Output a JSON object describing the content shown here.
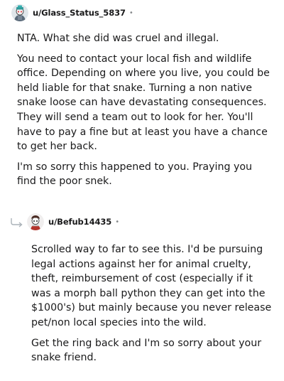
{
  "comment": {
    "author": "u/Glass_Status_5837",
    "separator": "•",
    "paragraphs": [
      "NTA. What she did was cruel and illegal.",
      "You need to contact your local fish and wildlife office. Depending on where you live, you could be held liable for that snake. Turning a non native snake loose can have devastating consequences. They will send a team out to look for her. You'll have to pay a fine but at least you have a chance to get her back.",
      "I'm so sorry this happened to you. Praying you find the poor snek."
    ]
  },
  "reply": {
    "author": "u/Befub14435",
    "separator": "•",
    "paragraphs": [
      "Scrolled way to far to see this. I'd be pursuing legal actions against her for animal cruelty, theft, reimbursement of cost (especially if it was a morph ball python they can get into the $1000's) but mainly because you never release pet/non local species into the wild.",
      "Get the ring back and I'm so sorry about your snake friend."
    ]
  },
  "icons": {
    "avatar1": "snoo-avatar-icon",
    "avatar2": "snoo-avatar-icon",
    "reply": "reply-arrow-icon"
  }
}
